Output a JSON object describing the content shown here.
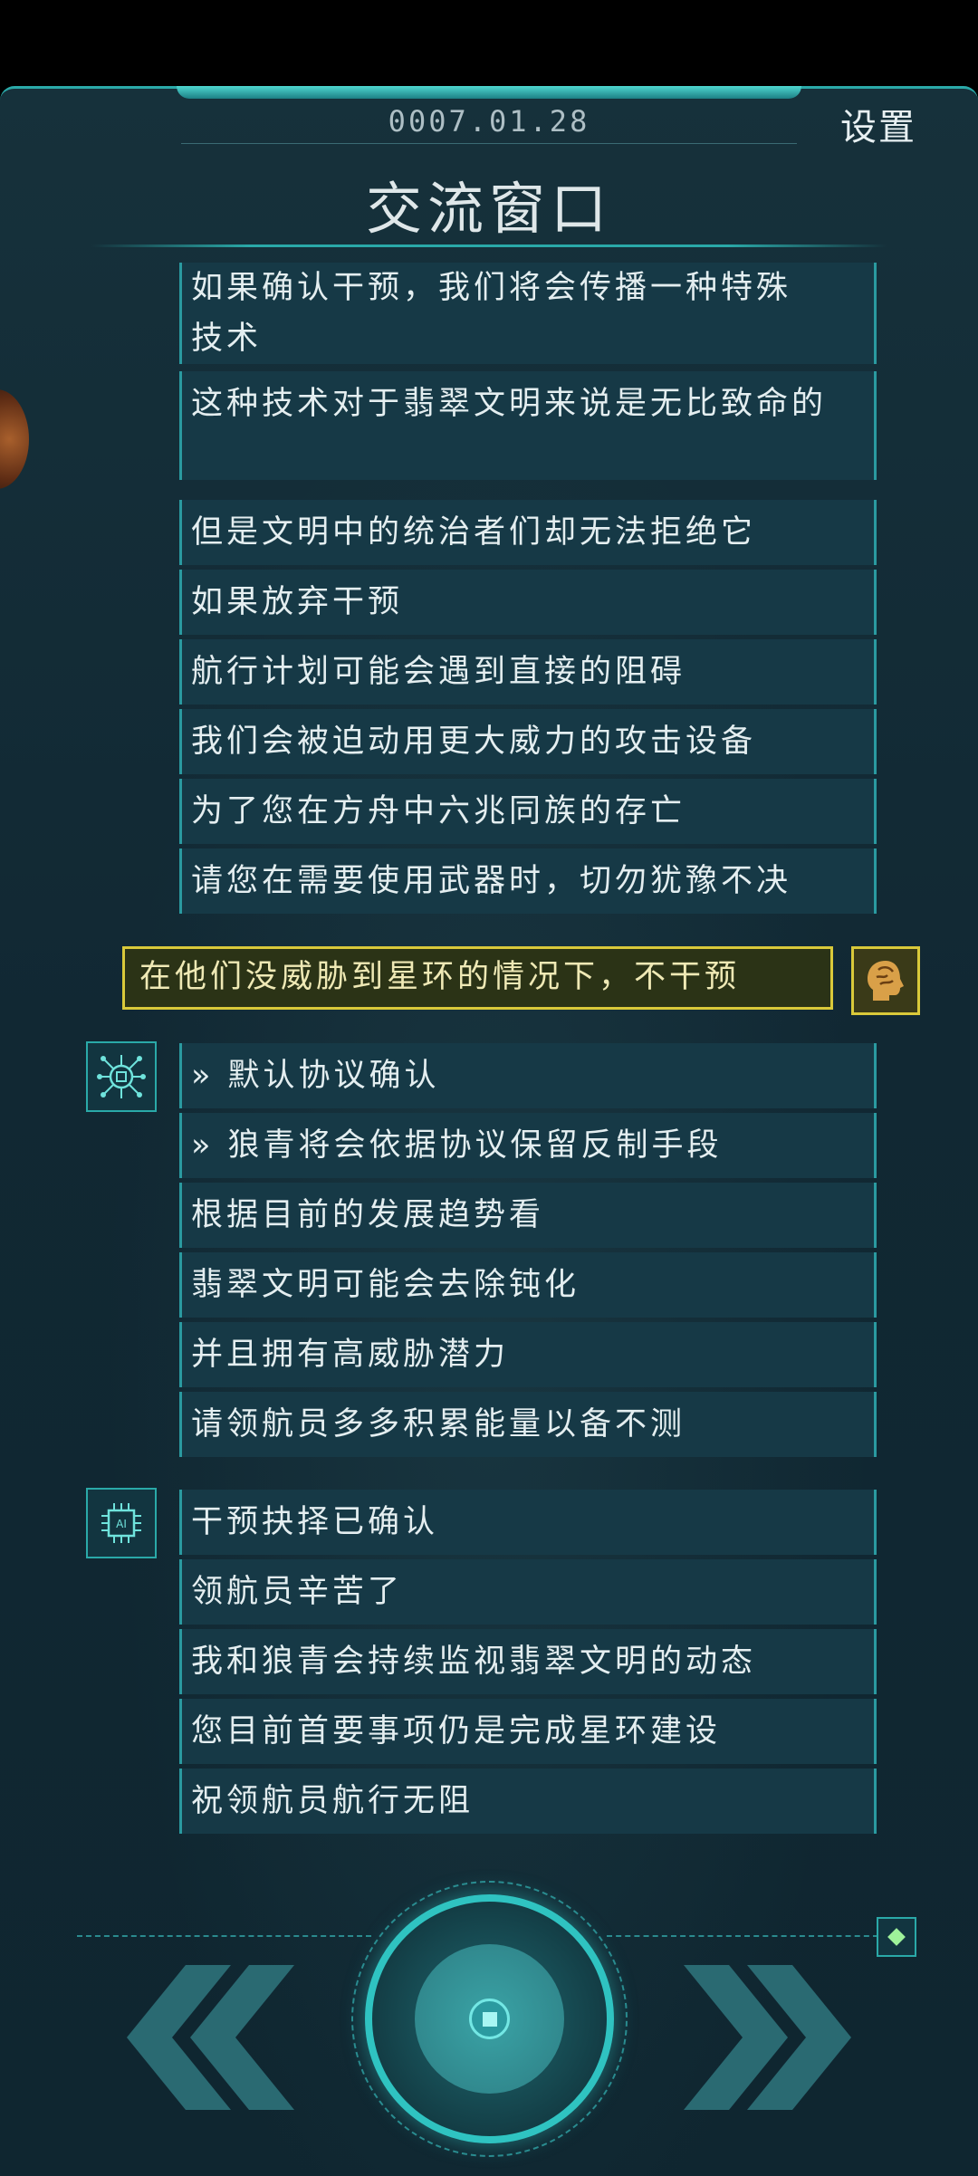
{
  "header": {
    "date": "0007.01.28",
    "settings_label": "设置",
    "title": "交流窗口"
  },
  "messages_top": [
    "如果确认干预，我们将会传播一种特殊",
    "技术",
    "这种技术对于翡翠文明来说是无比致命的",
    "但是文明中的统治者们却无法拒绝它",
    "如果放弃干预",
    "航行计划可能会遇到直接的阻碍",
    "我们会被迫动用更大威力的攻击设备",
    "为了您在方舟中六兆同族的存亡",
    "请您在需要使用武器时，切勿犹豫不决"
  ],
  "player_reply": "在他们没威胁到星环的情况下，不干预",
  "messages_mid": [
    "» 默认协议确认",
    "» 狼青将会依据协议保留反制手段",
    "根据目前的发展趋势看",
    "翡翠文明可能会去除钝化",
    "并且拥有高威胁潜力",
    "请领航员多多积累能量以备不测"
  ],
  "messages_bottom": [
    "干预抉择已确认",
    "领航员辛苦了",
    "我和狼青会持续监视翡翠文明的动态",
    "您目前首要事项仍是完成星环建设",
    "祝领航员航行无阻"
  ],
  "ai_badge": "AI",
  "icons": {
    "prev": "double-chevron-left-icon",
    "next": "double-chevron-right-icon",
    "center": "stop-icon",
    "gem": "diamond-icon"
  },
  "colors": {
    "accent": "#2aa9a8",
    "player": "#d9c93a",
    "bubble": "#163946"
  }
}
